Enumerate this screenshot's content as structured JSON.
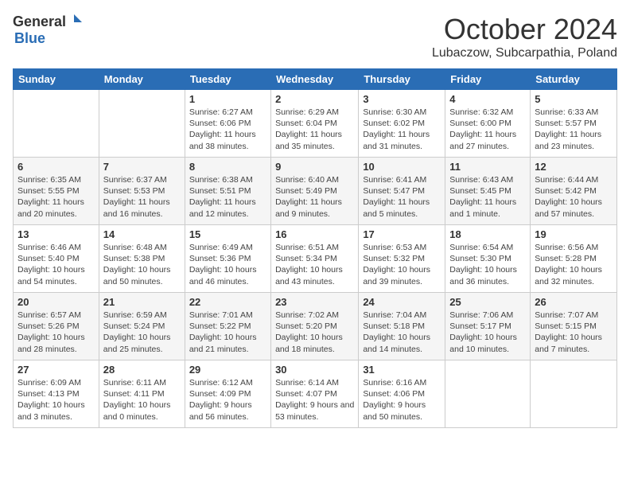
{
  "header": {
    "logo_general": "General",
    "logo_blue": "Blue",
    "month": "October 2024",
    "location": "Lubaczow, Subcarpathia, Poland"
  },
  "weekdays": [
    "Sunday",
    "Monday",
    "Tuesday",
    "Wednesday",
    "Thursday",
    "Friday",
    "Saturday"
  ],
  "weeks": [
    [
      {
        "day": "",
        "sunrise": "",
        "sunset": "",
        "daylight": ""
      },
      {
        "day": "",
        "sunrise": "",
        "sunset": "",
        "daylight": ""
      },
      {
        "day": "1",
        "sunrise": "Sunrise: 6:27 AM",
        "sunset": "Sunset: 6:06 PM",
        "daylight": "Daylight: 11 hours and 38 minutes."
      },
      {
        "day": "2",
        "sunrise": "Sunrise: 6:29 AM",
        "sunset": "Sunset: 6:04 PM",
        "daylight": "Daylight: 11 hours and 35 minutes."
      },
      {
        "day": "3",
        "sunrise": "Sunrise: 6:30 AM",
        "sunset": "Sunset: 6:02 PM",
        "daylight": "Daylight: 11 hours and 31 minutes."
      },
      {
        "day": "4",
        "sunrise": "Sunrise: 6:32 AM",
        "sunset": "Sunset: 6:00 PM",
        "daylight": "Daylight: 11 hours and 27 minutes."
      },
      {
        "day": "5",
        "sunrise": "Sunrise: 6:33 AM",
        "sunset": "Sunset: 5:57 PM",
        "daylight": "Daylight: 11 hours and 23 minutes."
      }
    ],
    [
      {
        "day": "6",
        "sunrise": "Sunrise: 6:35 AM",
        "sunset": "Sunset: 5:55 PM",
        "daylight": "Daylight: 11 hours and 20 minutes."
      },
      {
        "day": "7",
        "sunrise": "Sunrise: 6:37 AM",
        "sunset": "Sunset: 5:53 PM",
        "daylight": "Daylight: 11 hours and 16 minutes."
      },
      {
        "day": "8",
        "sunrise": "Sunrise: 6:38 AM",
        "sunset": "Sunset: 5:51 PM",
        "daylight": "Daylight: 11 hours and 12 minutes."
      },
      {
        "day": "9",
        "sunrise": "Sunrise: 6:40 AM",
        "sunset": "Sunset: 5:49 PM",
        "daylight": "Daylight: 11 hours and 9 minutes."
      },
      {
        "day": "10",
        "sunrise": "Sunrise: 6:41 AM",
        "sunset": "Sunset: 5:47 PM",
        "daylight": "Daylight: 11 hours and 5 minutes."
      },
      {
        "day": "11",
        "sunrise": "Sunrise: 6:43 AM",
        "sunset": "Sunset: 5:45 PM",
        "daylight": "Daylight: 11 hours and 1 minute."
      },
      {
        "day": "12",
        "sunrise": "Sunrise: 6:44 AM",
        "sunset": "Sunset: 5:42 PM",
        "daylight": "Daylight: 10 hours and 57 minutes."
      }
    ],
    [
      {
        "day": "13",
        "sunrise": "Sunrise: 6:46 AM",
        "sunset": "Sunset: 5:40 PM",
        "daylight": "Daylight: 10 hours and 54 minutes."
      },
      {
        "day": "14",
        "sunrise": "Sunrise: 6:48 AM",
        "sunset": "Sunset: 5:38 PM",
        "daylight": "Daylight: 10 hours and 50 minutes."
      },
      {
        "day": "15",
        "sunrise": "Sunrise: 6:49 AM",
        "sunset": "Sunset: 5:36 PM",
        "daylight": "Daylight: 10 hours and 46 minutes."
      },
      {
        "day": "16",
        "sunrise": "Sunrise: 6:51 AM",
        "sunset": "Sunset: 5:34 PM",
        "daylight": "Daylight: 10 hours and 43 minutes."
      },
      {
        "day": "17",
        "sunrise": "Sunrise: 6:53 AM",
        "sunset": "Sunset: 5:32 PM",
        "daylight": "Daylight: 10 hours and 39 minutes."
      },
      {
        "day": "18",
        "sunrise": "Sunrise: 6:54 AM",
        "sunset": "Sunset: 5:30 PM",
        "daylight": "Daylight: 10 hours and 36 minutes."
      },
      {
        "day": "19",
        "sunrise": "Sunrise: 6:56 AM",
        "sunset": "Sunset: 5:28 PM",
        "daylight": "Daylight: 10 hours and 32 minutes."
      }
    ],
    [
      {
        "day": "20",
        "sunrise": "Sunrise: 6:57 AM",
        "sunset": "Sunset: 5:26 PM",
        "daylight": "Daylight: 10 hours and 28 minutes."
      },
      {
        "day": "21",
        "sunrise": "Sunrise: 6:59 AM",
        "sunset": "Sunset: 5:24 PM",
        "daylight": "Daylight: 10 hours and 25 minutes."
      },
      {
        "day": "22",
        "sunrise": "Sunrise: 7:01 AM",
        "sunset": "Sunset: 5:22 PM",
        "daylight": "Daylight: 10 hours and 21 minutes."
      },
      {
        "day": "23",
        "sunrise": "Sunrise: 7:02 AM",
        "sunset": "Sunset: 5:20 PM",
        "daylight": "Daylight: 10 hours and 18 minutes."
      },
      {
        "day": "24",
        "sunrise": "Sunrise: 7:04 AM",
        "sunset": "Sunset: 5:18 PM",
        "daylight": "Daylight: 10 hours and 14 minutes."
      },
      {
        "day": "25",
        "sunrise": "Sunrise: 7:06 AM",
        "sunset": "Sunset: 5:17 PM",
        "daylight": "Daylight: 10 hours and 10 minutes."
      },
      {
        "day": "26",
        "sunrise": "Sunrise: 7:07 AM",
        "sunset": "Sunset: 5:15 PM",
        "daylight": "Daylight: 10 hours and 7 minutes."
      }
    ],
    [
      {
        "day": "27",
        "sunrise": "Sunrise: 6:09 AM",
        "sunset": "Sunset: 4:13 PM",
        "daylight": "Daylight: 10 hours and 3 minutes."
      },
      {
        "day": "28",
        "sunrise": "Sunrise: 6:11 AM",
        "sunset": "Sunset: 4:11 PM",
        "daylight": "Daylight: 10 hours and 0 minutes."
      },
      {
        "day": "29",
        "sunrise": "Sunrise: 6:12 AM",
        "sunset": "Sunset: 4:09 PM",
        "daylight": "Daylight: 9 hours and 56 minutes."
      },
      {
        "day": "30",
        "sunrise": "Sunrise: 6:14 AM",
        "sunset": "Sunset: 4:07 PM",
        "daylight": "Daylight: 9 hours and 53 minutes."
      },
      {
        "day": "31",
        "sunrise": "Sunrise: 6:16 AM",
        "sunset": "Sunset: 4:06 PM",
        "daylight": "Daylight: 9 hours and 50 minutes."
      },
      {
        "day": "",
        "sunrise": "",
        "sunset": "",
        "daylight": ""
      },
      {
        "day": "",
        "sunrise": "",
        "sunset": "",
        "daylight": ""
      }
    ]
  ]
}
